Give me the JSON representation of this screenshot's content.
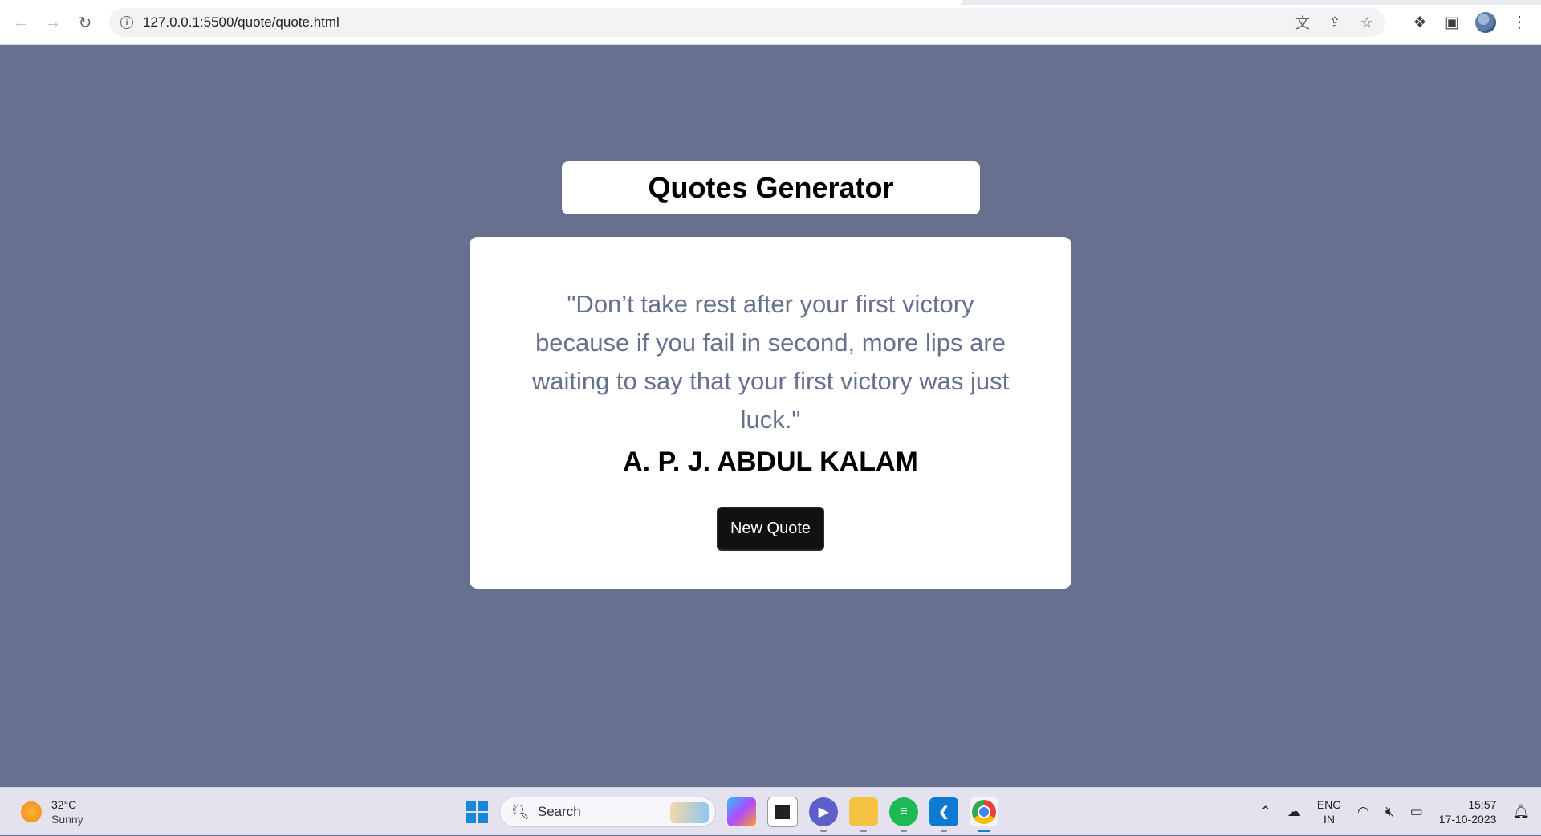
{
  "browser": {
    "url": "127.0.0.1:5500/quote/quote.html",
    "nav": {
      "back_icon": "arrow-left",
      "forward_icon": "arrow-right",
      "reload_icon": "reload"
    },
    "omnibox_actions": [
      "translate-icon",
      "share-icon",
      "bookmark-star-icon"
    ],
    "toolbar_icons": [
      "extensions-icon",
      "side-panel-icon",
      "profile-avatar",
      "menu-icon"
    ]
  },
  "page": {
    "title": "Quotes Generator",
    "quote_text": "\"Don’t take rest after your first victory because if you fail in second, more lips are waiting to say that your first victory was just luck.\"",
    "author": "A. P. J. ABDUL KALAM",
    "button_label": "New Quote",
    "background_color": "#67718f",
    "quote_color": "#67718f"
  },
  "taskbar": {
    "weather_temp": "32°C",
    "weather_condition": "Sunny",
    "search_placeholder": "Search",
    "apps": [
      "windows-start",
      "copilot",
      "task-view",
      "teams",
      "file-explorer",
      "spotify",
      "vscode",
      "chrome"
    ],
    "language_line1": "ENG",
    "language_line2": "IN",
    "time": "15:57",
    "date": "17-10-2023"
  }
}
